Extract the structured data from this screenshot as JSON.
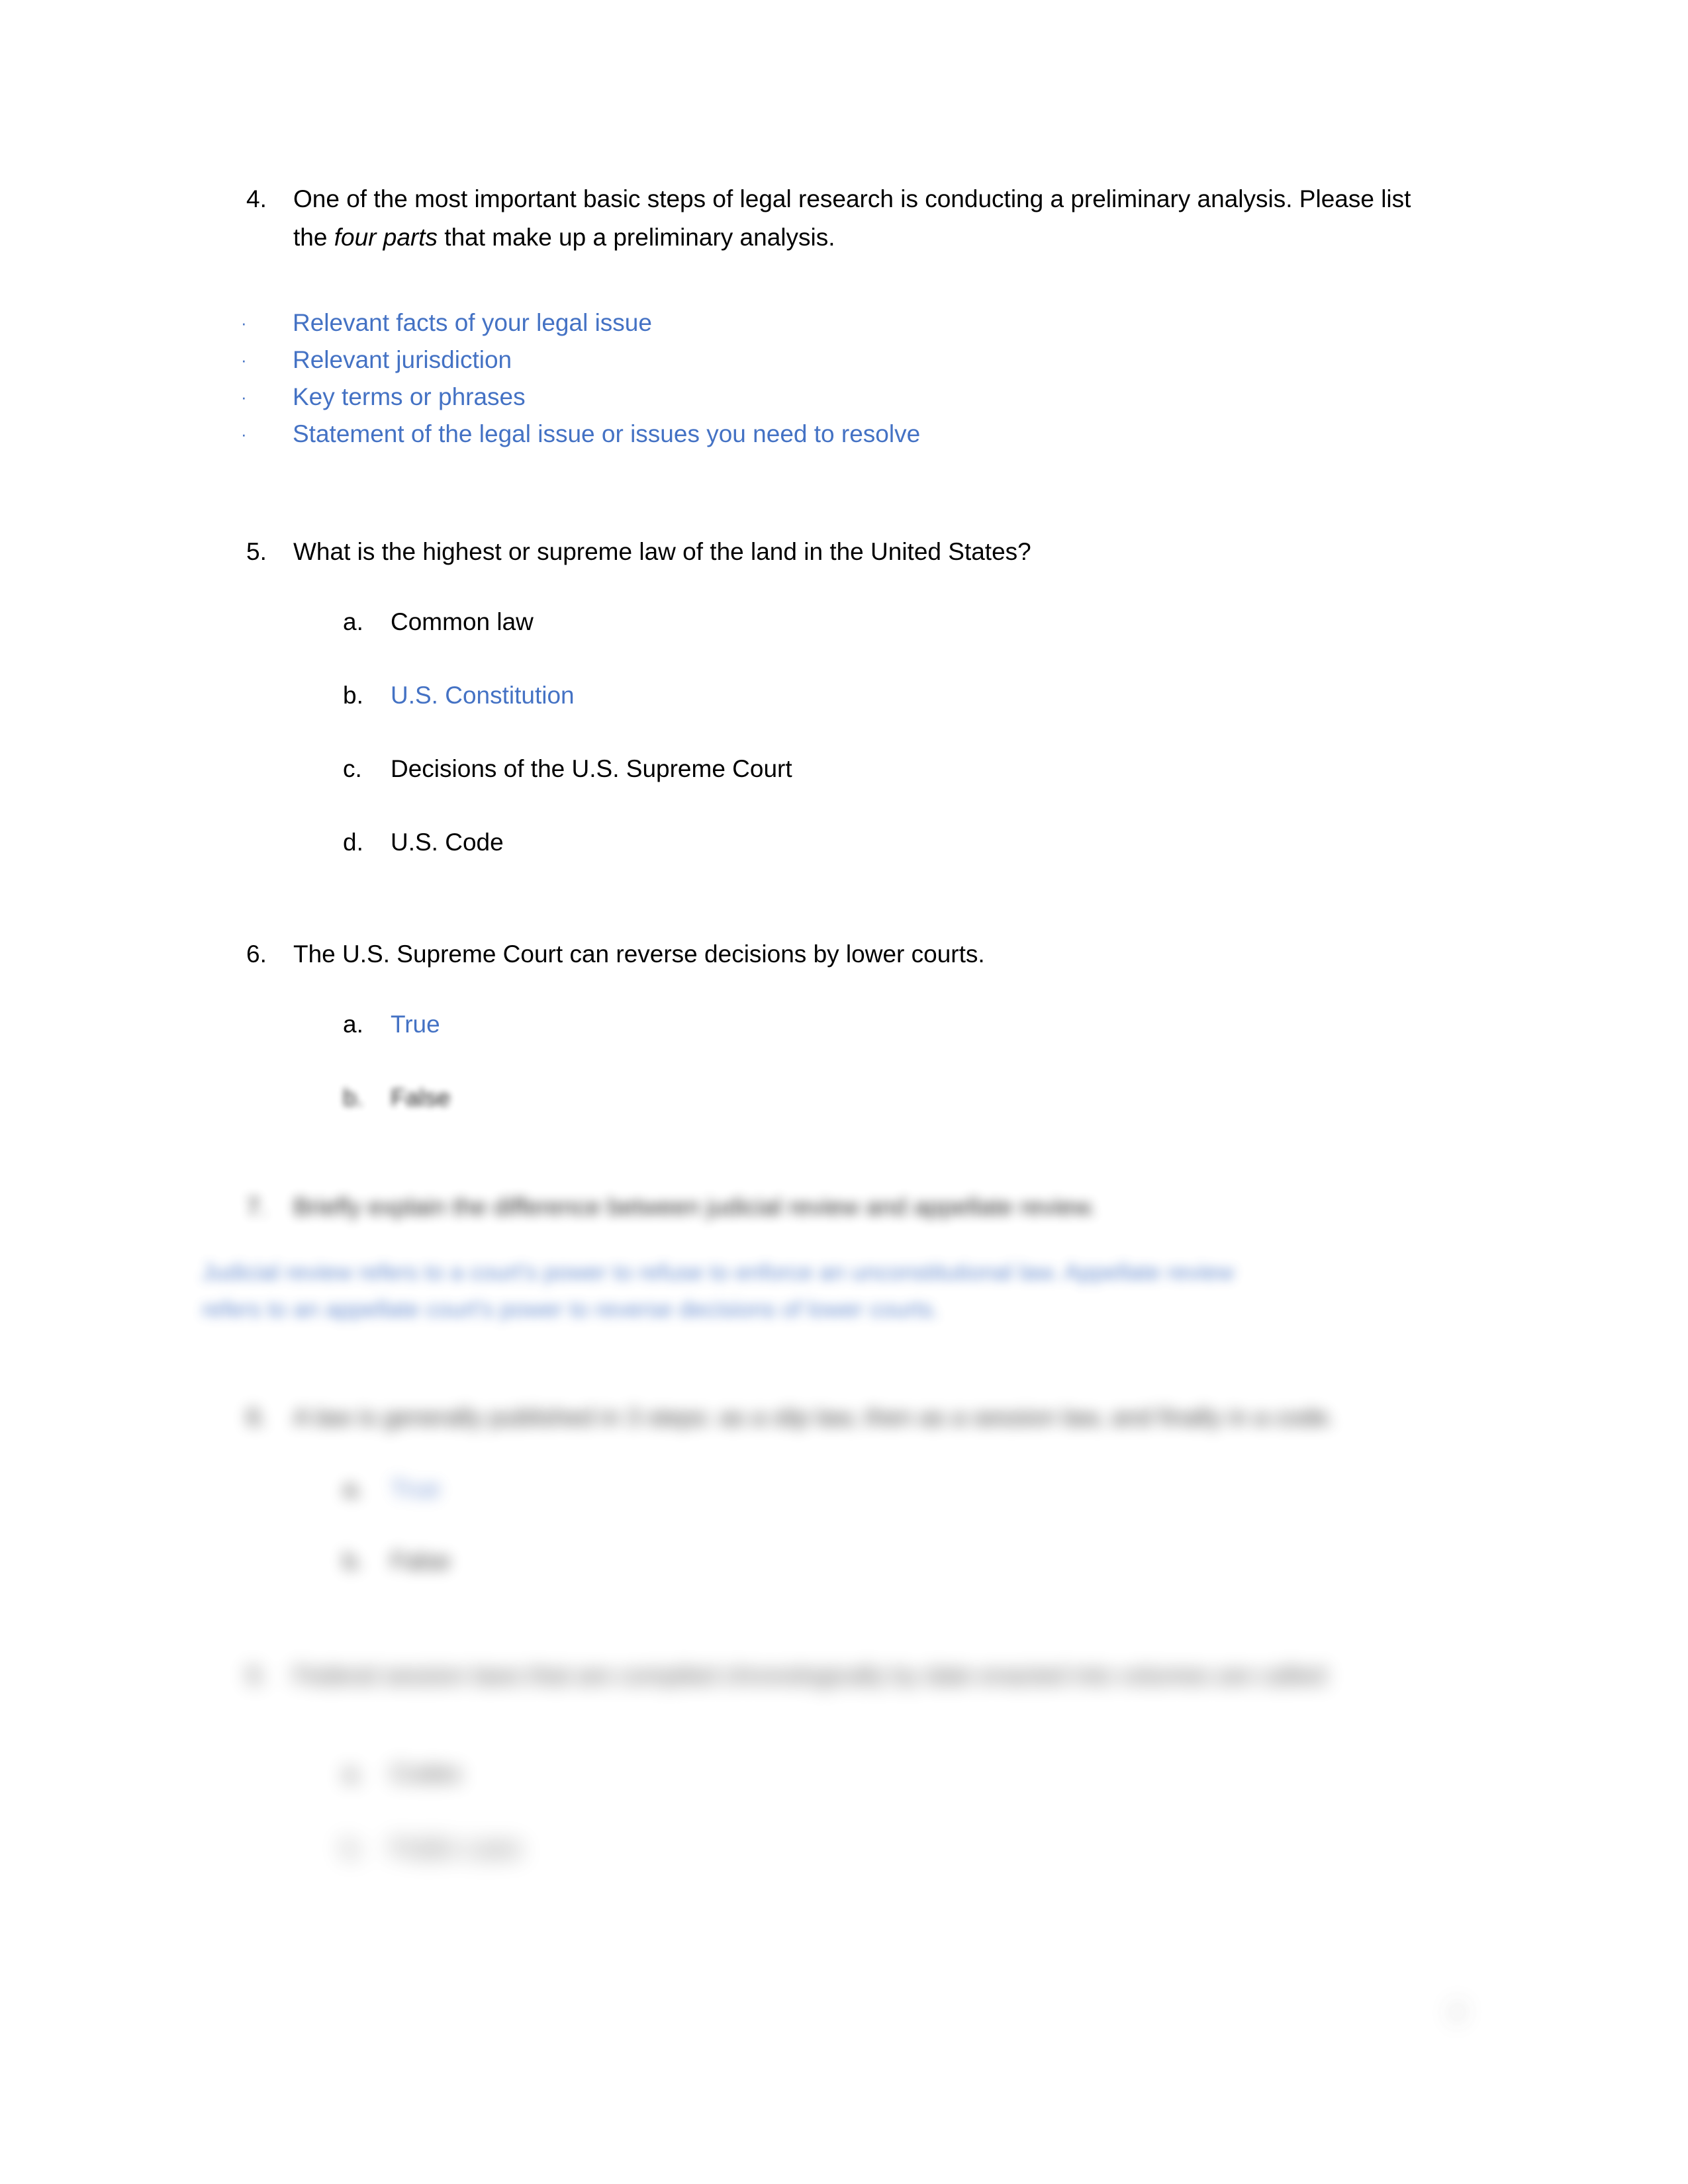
{
  "document": {
    "type": "quiz-worksheet",
    "subject": "Legal Research",
    "page_number": "2",
    "answer_color": "#4472C4",
    "text_color": "#000000",
    "background": "#ffffff"
  },
  "questions": [
    {
      "number": "4.",
      "text_line_1": "One of the most important basic steps of legal research is conducting a preliminary analysis.",
      "text_line_2_pre": "Please list the ",
      "text_line_2_em": "four parts",
      "text_line_2_post": " that make up a preliminary analysis.",
      "answer_type": "bulleted-list",
      "bullet_marker": "·",
      "answers": [
        "Relevant facts of your legal issue",
        "Relevant jurisdiction",
        "Key terms or phrases",
        "Statement of the legal issue or issues you need to resolve"
      ]
    },
    {
      "number": "5.",
      "text": "What is the highest or supreme law of the land in the United States?",
      "answer_type": "multiple-choice",
      "options": [
        {
          "letter": "a.",
          "label": "Common law",
          "selected": false
        },
        {
          "letter": "b.",
          "label": "U.S. Constitution",
          "selected": true
        },
        {
          "letter": "c.",
          "label": "Decisions of the U.S. Supreme Court",
          "selected": false
        },
        {
          "letter": "d.",
          "label": "U.S. Code",
          "selected": false
        }
      ]
    },
    {
      "number": "6.",
      "text": "The U.S. Supreme Court can reverse decisions by lower courts.",
      "answer_type": "true-false",
      "options": [
        {
          "letter": "a.",
          "label": "True",
          "selected": true
        },
        {
          "letter": "b.",
          "label": "False",
          "selected": false
        }
      ]
    },
    {
      "number": "7.",
      "text": "Briefly explain the difference between judicial review and appellate review.",
      "answer_type": "free-response",
      "answer_line_1": "Judicial review refers to a court's power to refuse to enforce an unconstitutional law.  Appellate review",
      "answer_line_2": "refers to an appellate court's power to reverse decisions of lower courts."
    },
    {
      "number": "8.",
      "text": "A law is generally published in 3 steps: as a slip law, then as a session law, and finally in a code.",
      "answer_type": "true-false",
      "options": [
        {
          "letter": "a.",
          "label": "True",
          "selected": true
        },
        {
          "letter": "b.",
          "label": "False",
          "selected": false
        }
      ]
    },
    {
      "number": "9.",
      "text_line_1": "Federal session laws that are compiled chronologically by date enacted into volumes are",
      "text_line_2": "called:",
      "answer_type": "multiple-choice",
      "options": [
        {
          "letter": "a.",
          "label": "Codes",
          "selected": false
        },
        {
          "letter": "b.",
          "label": "Public Laws",
          "selected": false
        }
      ]
    }
  ]
}
